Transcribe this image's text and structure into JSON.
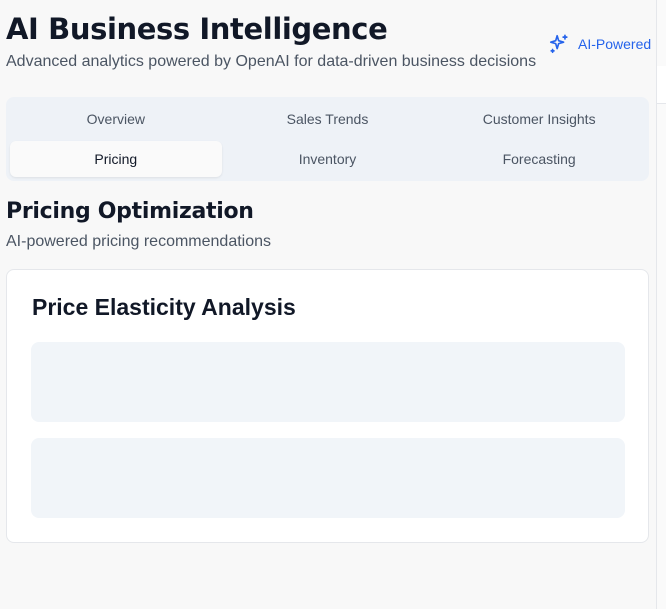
{
  "header": {
    "title": "AI Business Intelligence",
    "subtitle": "Advanced analytics powered by OpenAI for data-driven business decisions",
    "badge_label": "AI-Powered",
    "badge_icon": "sparkles-icon",
    "accent_color": "#2563eb"
  },
  "tabs": [
    {
      "label": "Overview",
      "active": false
    },
    {
      "label": "Sales Trends",
      "active": false
    },
    {
      "label": "Customer Insights",
      "active": false
    },
    {
      "label": "Pricing",
      "active": true
    },
    {
      "label": "Inventory",
      "active": false
    },
    {
      "label": "Forecasting",
      "active": false
    }
  ],
  "section": {
    "title": "Pricing Optimization",
    "subtitle": "AI-powered pricing recommendations"
  },
  "card": {
    "title": "Price Elasticity Analysis"
  }
}
